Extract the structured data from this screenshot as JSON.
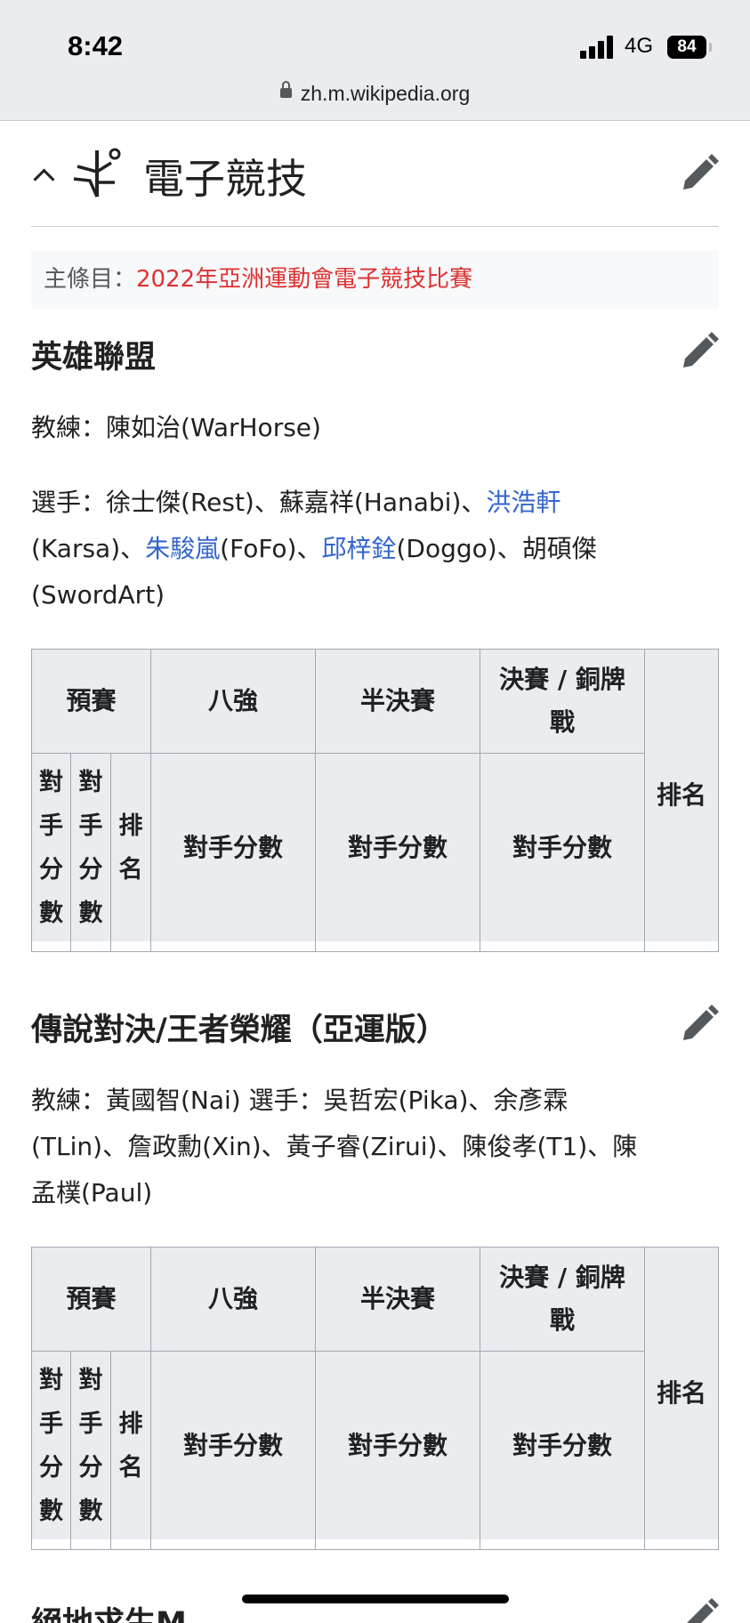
{
  "status": {
    "time": "8:42",
    "network": "4G",
    "battery": "84",
    "url": "zh.m.wikipedia.org"
  },
  "section": {
    "title": "電子競技",
    "hatnote_prefix": "主條目：",
    "hatnote_link": "2022年亞洲運動會電子競技比賽"
  },
  "lol": {
    "heading": "英雄聯盟",
    "coach_label": "教練：",
    "coach": "陳如治(WarHorse)",
    "players": {
      "label": "選手：",
      "p1": "徐士傑(Rest)、蘇嘉祥(Hanabi)、",
      "p2_link": "洪浩軒",
      "p2_rest": "(Karsa)、",
      "p3_link": "朱駿嵐",
      "p3_rest": "(FoFo)、",
      "p4_link": "邱梓銓",
      "p4_rest": "(Doggo)、胡碩傑",
      "p5": "(SwordArt)"
    }
  },
  "aov": {
    "heading": "傳說對決/王者榮耀（亞運版）",
    "line1": "教練：黃國智(Nai) 選手：吳哲宏(Pika)、余彥霖",
    "line2": "(TLin)、詹政勳(Xin)、黃子睿(Zirui)、陳俊孝(T1)、陳",
    "line3": "孟樸(Paul)"
  },
  "table": {
    "prelim": "預賽",
    "quarter": "八強",
    "semi": "半決賽",
    "final_a": "決賽 / 銅牌",
    "final_b": "戰",
    "rank": "排名",
    "sub_v1": [
      "對",
      "手",
      "分",
      "數"
    ],
    "sub_v3": [
      "排",
      "名"
    ],
    "opp_score": "對手分數"
  },
  "next_heading": "絕地求生M"
}
